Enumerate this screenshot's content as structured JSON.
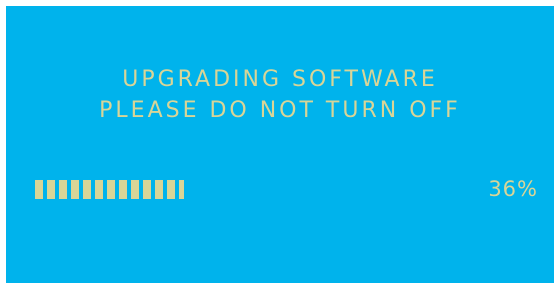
{
  "screen": {
    "background_color": "#00b3ec",
    "text_color": "#d9d597",
    "message_line1": "UPGRADING SOFTWARE",
    "message_line2": "PLEASE DO NOT TURN OFF"
  },
  "progress": {
    "percent_label": "36%",
    "value": 0.36
  }
}
